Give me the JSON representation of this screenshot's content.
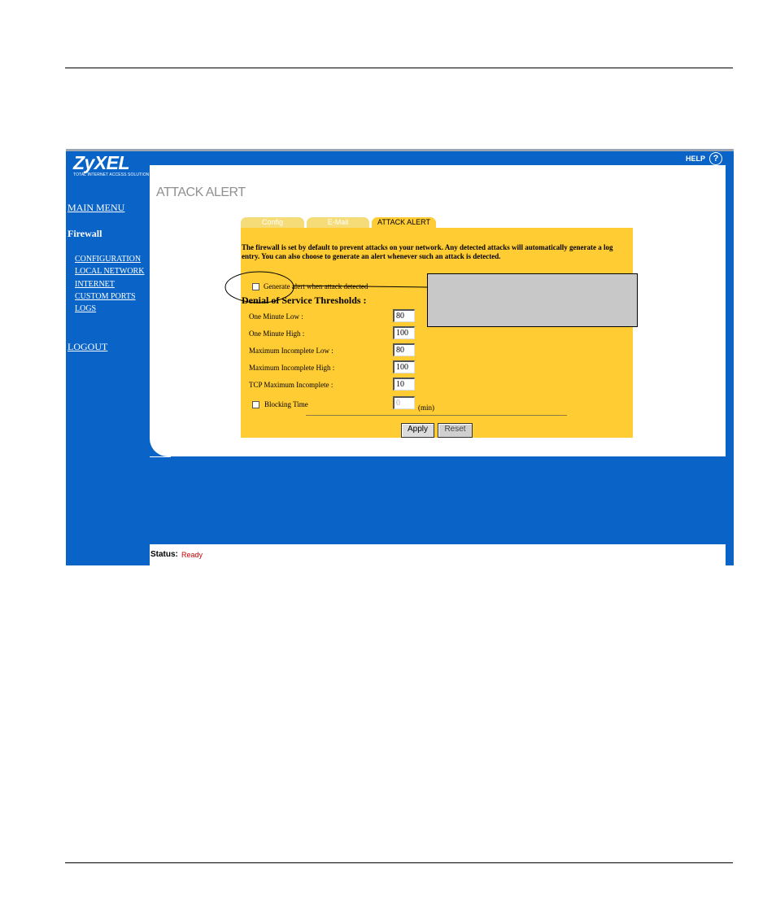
{
  "brand": {
    "name": "ZyXEL",
    "tagline": "TOTAL INTERNET ACCESS SOLUTION"
  },
  "help": {
    "label": "HELP",
    "icon": "question-circle-icon",
    "glyph": "?"
  },
  "nav": {
    "main_menu": "MAIN MENU",
    "section": "Firewall",
    "items": [
      {
        "label": "CONFIGURATION"
      },
      {
        "label": "LOCAL NETWORK"
      },
      {
        "label": "INTERNET"
      },
      {
        "label": "CUSTOM PORTS"
      },
      {
        "label": "LOGS"
      }
    ],
    "logout": "LOGOUT"
  },
  "page": {
    "title": "ATTACK ALERT"
  },
  "tabs": [
    {
      "label": "Config",
      "active": false
    },
    {
      "label": "E-Mail",
      "active": false
    },
    {
      "label": "ATTACK ALERT",
      "active": true
    }
  ],
  "form": {
    "description": "The firewall is set by default to prevent attacks on your network. Any detected attacks will automatically generate a log entry. You can also choose to generate an alert whenever such an attack is detected.",
    "generate_alert_label": "Generate alert when attack detected",
    "generate_alert_checked": false,
    "dos_title": "Denial of Service Thresholds :",
    "fields": [
      {
        "label": "One Minute Low :",
        "value": "80"
      },
      {
        "label": "One Minute High :",
        "value": "100"
      },
      {
        "label": "Maximum Incomplete Low :",
        "value": "80"
      },
      {
        "label": "Maximum Incomplete High :",
        "value": "100"
      },
      {
        "label": "TCP Maximum Incomplete :",
        "value": "10"
      }
    ],
    "blocking_time_label": "Blocking Time",
    "blocking_time_checked": false,
    "blocking_time_value": "0",
    "blocking_time_unit": "(min)",
    "apply_label": "Apply",
    "reset_label": "Reset"
  },
  "status": {
    "label": "Status:",
    "value": "Ready"
  },
  "colors": {
    "background_blue": "#0a64c8",
    "form_yellow": "#ffcc33",
    "status_red": "#cc0000"
  }
}
